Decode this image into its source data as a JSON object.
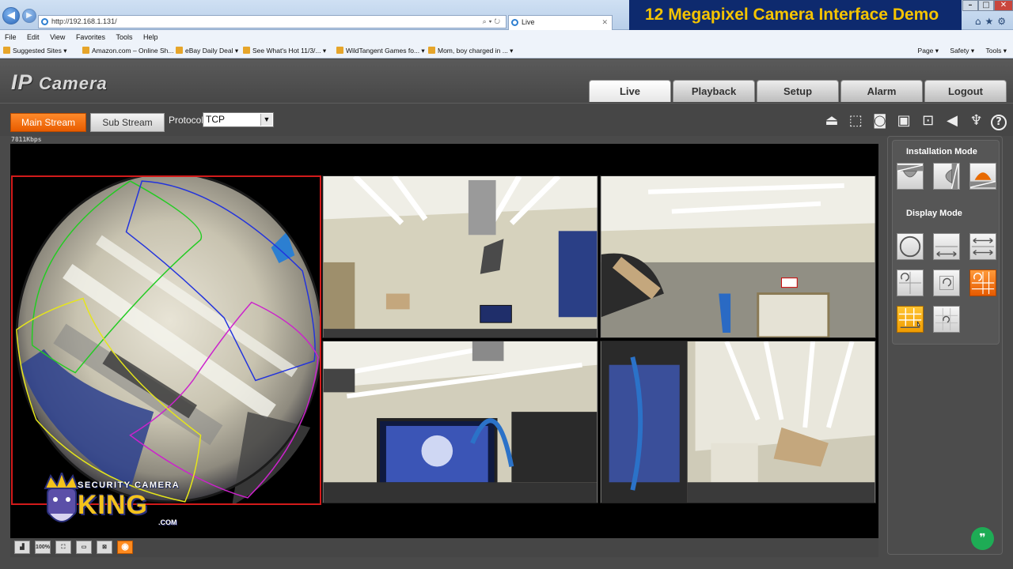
{
  "browser": {
    "address": "http://192.168.1.131/",
    "tab_title": "Live",
    "banner": "12 Megapixel Camera Interface Demo",
    "menu": [
      "File",
      "Edit",
      "View",
      "Favorites",
      "Tools",
      "Help"
    ],
    "favorites": [
      "Suggested Sites ▾",
      "Amazon.com – Online Sh...",
      "eBay Daily Deal ▾",
      "See What's Hot 11/3/... ▾",
      "WildTangent Games fo... ▾",
      "Mom, boy charged in ... ▾"
    ],
    "command_bar": [
      "Page ▾",
      "Safety ▾",
      "Tools ▾"
    ]
  },
  "camera": {
    "logo_main": "IP",
    "logo_sub": "Camera",
    "nav_tabs": [
      "Live",
      "Playback",
      "Setup",
      "Alarm",
      "Logout"
    ],
    "active_tab": "Live",
    "main_stream_label": "Main Stream",
    "sub_stream_label": "Sub Stream",
    "protocol_label": "Protocol",
    "protocol_value": "TCP",
    "bitrate": "7811Kbps",
    "zoom_label": "100%"
  },
  "panel": {
    "installation_mode_heading": "Installation Mode",
    "display_mode_heading": "Display Mode"
  },
  "watermark": {
    "top": "SECURITY CAMERA",
    "main": "KING",
    "suffix": ".COM"
  },
  "colors": {
    "accent": "#ff8a1e",
    "banner_text": "#f5c400",
    "banner_bg": "#0e2a6e",
    "selected_pane": "#d21b1b"
  }
}
